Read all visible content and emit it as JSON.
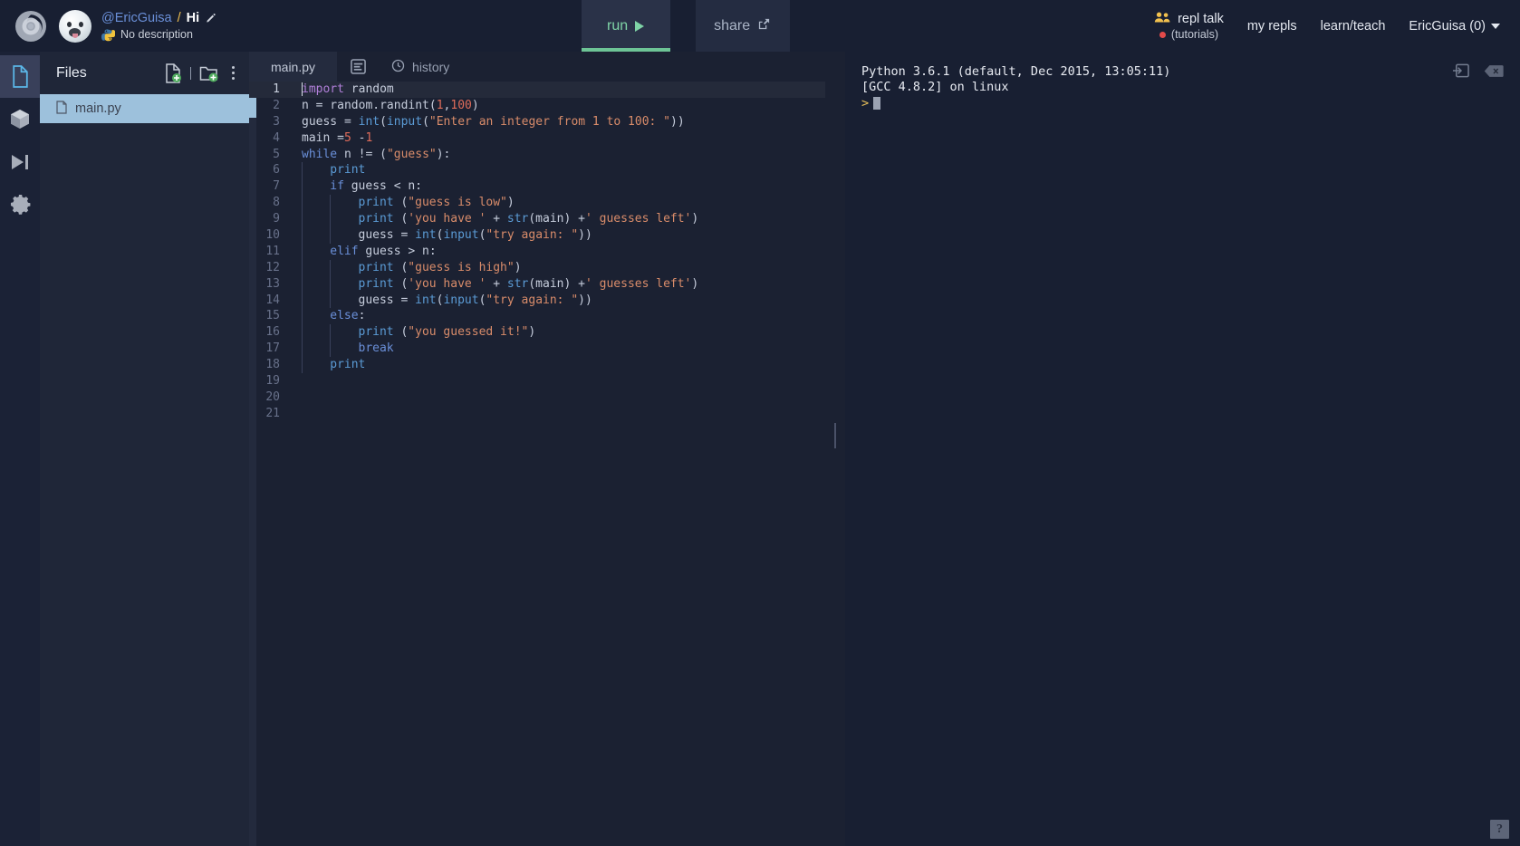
{
  "header": {
    "logo_icon": "replit-logo-icon",
    "avatar_icon": "user-avatar",
    "owner": "@EricGuisa",
    "slash": "/",
    "repl_name": "Hi",
    "edit_icon": "pencil-icon",
    "lang_icon": "python-logo-icon",
    "description": "No description",
    "run_label": "run",
    "run_icon": "play-icon",
    "share_label": "share",
    "share_icon": "share-export-icon",
    "repl_talk_label": "repl talk",
    "repl_talk_icon": "people-icon",
    "tutorials_label": "(tutorials)",
    "tutorials_dot": "red-dot-icon",
    "my_repls_label": "my repls",
    "learn_teach_label": "learn/teach",
    "user_label": "EricGuisa (0)",
    "user_caret_icon": "chevron-down-icon"
  },
  "rail": {
    "items": [
      {
        "name": "files",
        "icon": "file-icon",
        "active": true
      },
      {
        "name": "packages",
        "icon": "cube-icon",
        "active": false
      },
      {
        "name": "debugger",
        "icon": "step-over-icon",
        "active": false
      },
      {
        "name": "settings",
        "icon": "gear-icon",
        "active": false
      }
    ]
  },
  "files_panel": {
    "title": "Files",
    "add_file_icon": "add-file-icon",
    "add_folder_icon": "add-folder-icon",
    "menu_icon": "kebab-menu-icon",
    "files": [
      {
        "name": "main.py",
        "icon": "file-icon",
        "selected": true
      }
    ]
  },
  "editor": {
    "tabs": [
      {
        "label": "main.py",
        "active": true
      }
    ],
    "format_icon": "document-format-icon",
    "history_label": "history",
    "history_icon": "clock-history-icon",
    "line_count": 21,
    "cursor_line": 1,
    "code_lines": [
      {
        "n": 1,
        "indent": 0,
        "tokens": [
          {
            "t": "kw",
            "v": "import"
          },
          {
            "t": "def",
            "v": " random"
          }
        ]
      },
      {
        "n": 2,
        "indent": 0,
        "tokens": [
          {
            "t": "def",
            "v": "n = random.randint("
          },
          {
            "t": "num",
            "v": "1"
          },
          {
            "t": "def",
            "v": ","
          },
          {
            "t": "num",
            "v": "100"
          },
          {
            "t": "def",
            "v": ")"
          }
        ]
      },
      {
        "n": 3,
        "indent": 0,
        "tokens": [
          {
            "t": "def",
            "v": "guess = "
          },
          {
            "t": "fn",
            "v": "int"
          },
          {
            "t": "def",
            "v": "("
          },
          {
            "t": "fn",
            "v": "input"
          },
          {
            "t": "def",
            "v": "("
          },
          {
            "t": "str",
            "v": "\"Enter an integer from 1 to 100: \""
          },
          {
            "t": "def",
            "v": "))"
          }
        ]
      },
      {
        "n": 4,
        "indent": 0,
        "tokens": [
          {
            "t": "def",
            "v": "main ="
          },
          {
            "t": "num",
            "v": "5"
          },
          {
            "t": "def",
            "v": " -"
          },
          {
            "t": "num",
            "v": "1"
          }
        ]
      },
      {
        "n": 5,
        "indent": 0,
        "tokens": [
          {
            "t": "kw2",
            "v": "while"
          },
          {
            "t": "def",
            "v": " n != ("
          },
          {
            "t": "str",
            "v": "\"guess\""
          },
          {
            "t": "def",
            "v": "):"
          }
        ]
      },
      {
        "n": 6,
        "indent": 1,
        "tokens": [
          {
            "t": "fn",
            "v": "print"
          }
        ]
      },
      {
        "n": 7,
        "indent": 1,
        "tokens": [
          {
            "t": "kw2",
            "v": "if"
          },
          {
            "t": "def",
            "v": " guess < n:"
          }
        ]
      },
      {
        "n": 8,
        "indent": 2,
        "tokens": [
          {
            "t": "fn",
            "v": "print"
          },
          {
            "t": "def",
            "v": " ("
          },
          {
            "t": "str",
            "v": "\"guess is low\""
          },
          {
            "t": "def",
            "v": ")"
          }
        ]
      },
      {
        "n": 9,
        "indent": 2,
        "tokens": [
          {
            "t": "fn",
            "v": "print"
          },
          {
            "t": "def",
            "v": " ("
          },
          {
            "t": "str",
            "v": "'you have '"
          },
          {
            "t": "def",
            "v": " + "
          },
          {
            "t": "fn",
            "v": "str"
          },
          {
            "t": "def",
            "v": "(main) +"
          },
          {
            "t": "str",
            "v": "' guesses left'"
          },
          {
            "t": "def",
            "v": ")"
          }
        ]
      },
      {
        "n": 10,
        "indent": 2,
        "tokens": [
          {
            "t": "def",
            "v": "guess = "
          },
          {
            "t": "fn",
            "v": "int"
          },
          {
            "t": "def",
            "v": "("
          },
          {
            "t": "fn",
            "v": "input"
          },
          {
            "t": "def",
            "v": "("
          },
          {
            "t": "str",
            "v": "\"try again: \""
          },
          {
            "t": "def",
            "v": "))"
          }
        ]
      },
      {
        "n": 11,
        "indent": 1,
        "tokens": [
          {
            "t": "kw2",
            "v": "elif"
          },
          {
            "t": "def",
            "v": " guess > n:"
          }
        ]
      },
      {
        "n": 12,
        "indent": 2,
        "tokens": [
          {
            "t": "fn",
            "v": "print"
          },
          {
            "t": "def",
            "v": " ("
          },
          {
            "t": "str",
            "v": "\"guess is high\""
          },
          {
            "t": "def",
            "v": ")"
          }
        ]
      },
      {
        "n": 13,
        "indent": 2,
        "tokens": [
          {
            "t": "fn",
            "v": "print"
          },
          {
            "t": "def",
            "v": " ("
          },
          {
            "t": "str",
            "v": "'you have '"
          },
          {
            "t": "def",
            "v": " + "
          },
          {
            "t": "fn",
            "v": "str"
          },
          {
            "t": "def",
            "v": "(main) +"
          },
          {
            "t": "str",
            "v": "' guesses left'"
          },
          {
            "t": "def",
            "v": ")"
          }
        ]
      },
      {
        "n": 14,
        "indent": 2,
        "tokens": [
          {
            "t": "def",
            "v": "guess = "
          },
          {
            "t": "fn",
            "v": "int"
          },
          {
            "t": "def",
            "v": "("
          },
          {
            "t": "fn",
            "v": "input"
          },
          {
            "t": "def",
            "v": "("
          },
          {
            "t": "str",
            "v": "\"try again: \""
          },
          {
            "t": "def",
            "v": "))"
          }
        ]
      },
      {
        "n": 15,
        "indent": 1,
        "tokens": [
          {
            "t": "kw2",
            "v": "else"
          },
          {
            "t": "def",
            "v": ":"
          }
        ]
      },
      {
        "n": 16,
        "indent": 2,
        "tokens": [
          {
            "t": "fn",
            "v": "print"
          },
          {
            "t": "def",
            "v": " ("
          },
          {
            "t": "str",
            "v": "\"you guessed it!\""
          },
          {
            "t": "def",
            "v": ")"
          }
        ]
      },
      {
        "n": 17,
        "indent": 2,
        "tokens": [
          {
            "t": "kw2",
            "v": "break"
          }
        ]
      },
      {
        "n": 18,
        "indent": 1,
        "tokens": [
          {
            "t": "fn",
            "v": "print"
          }
        ]
      },
      {
        "n": 19,
        "indent": 0,
        "tokens": []
      },
      {
        "n": 20,
        "indent": 0,
        "tokens": []
      },
      {
        "n": 21,
        "indent": 0,
        "tokens": []
      }
    ]
  },
  "console": {
    "lines": [
      "Python 3.6.1 (default, Dec 2015, 13:05:11)",
      "[GCC 4.8.2] on linux"
    ],
    "prompt": ">",
    "maximize_icon": "open-in-pane-icon",
    "clear_icon": "clear-console-icon",
    "help_label": "?"
  },
  "colors": {
    "accent_green": "#6dc496",
    "selection_blue": "#9dc1dc",
    "bg_dark": "#181f32",
    "panel": "#1f2638",
    "string": "#d98c6a",
    "keyword": "#b07fd8",
    "function": "#5b9bd5",
    "number": "#e06c5a",
    "yellow": "#f2c14e"
  }
}
